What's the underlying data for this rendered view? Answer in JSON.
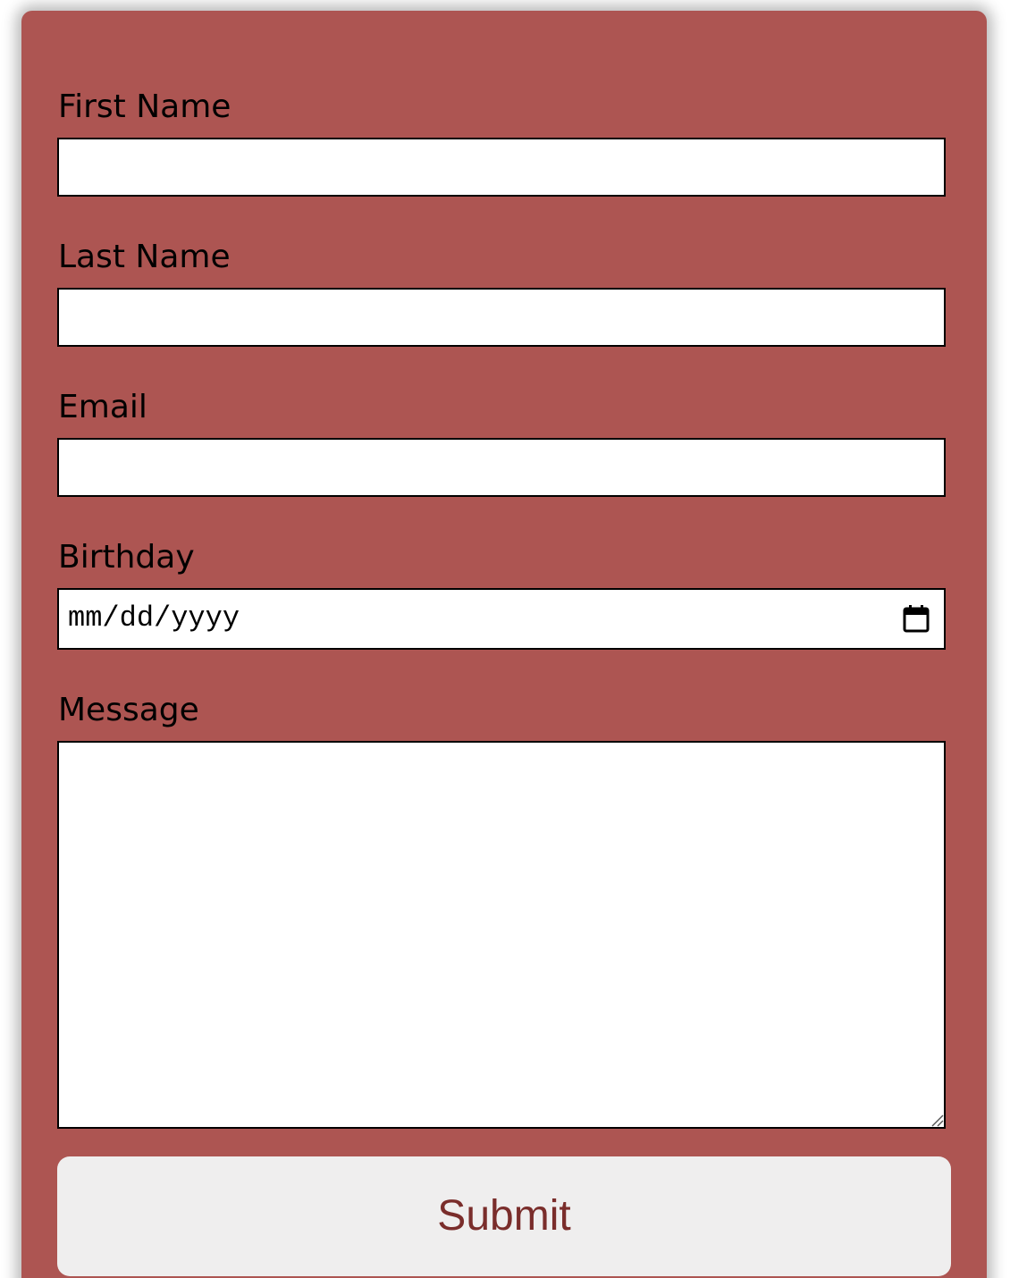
{
  "form": {
    "fields": {
      "first_name": {
        "label": "First Name",
        "value": ""
      },
      "last_name": {
        "label": "Last Name",
        "value": ""
      },
      "email": {
        "label": "Email",
        "value": ""
      },
      "birthday": {
        "label": "Birthday",
        "placeholder": "mm/dd/yyyy",
        "icon": "calendar-icon"
      },
      "message": {
        "label": "Message",
        "value": "",
        "icon": "resize-grip-icon"
      }
    },
    "submit_label": "Submit"
  },
  "colors": {
    "card_background": "#ad5552",
    "button_background": "#efeeee",
    "button_text": "#7a2d2b",
    "field_background": "#ffffff",
    "field_border": "#000000"
  }
}
